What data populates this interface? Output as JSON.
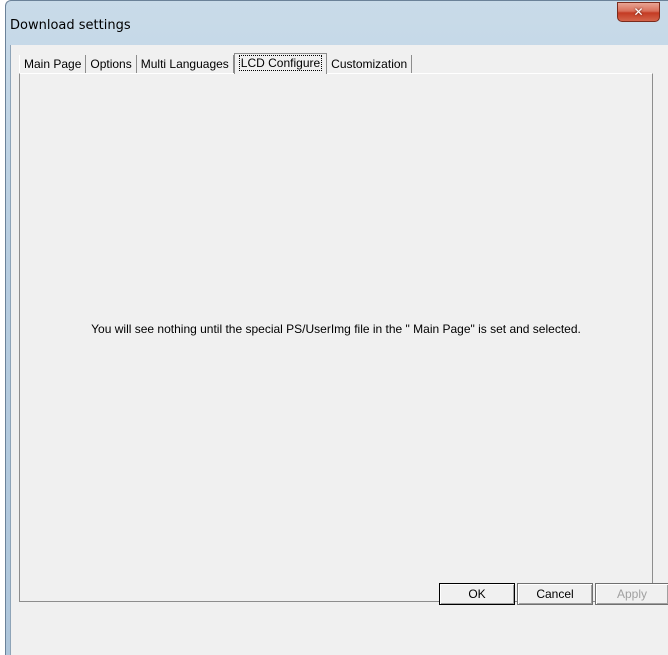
{
  "window": {
    "title": "Download settings"
  },
  "tabs": [
    {
      "label": "Main Page",
      "active": false
    },
    {
      "label": "Options",
      "active": false
    },
    {
      "label": "Multi Languages",
      "active": false
    },
    {
      "label": "LCD Configure",
      "active": true
    },
    {
      "label": "Customization",
      "active": false
    }
  ],
  "panel": {
    "message": "You will see nothing until the special PS/UserImg file in the \" Main Page\" is set and selected."
  },
  "buttons": {
    "ok": "OK",
    "cancel": "Cancel",
    "apply": "Apply"
  },
  "icons": {
    "close": "close-icon"
  }
}
